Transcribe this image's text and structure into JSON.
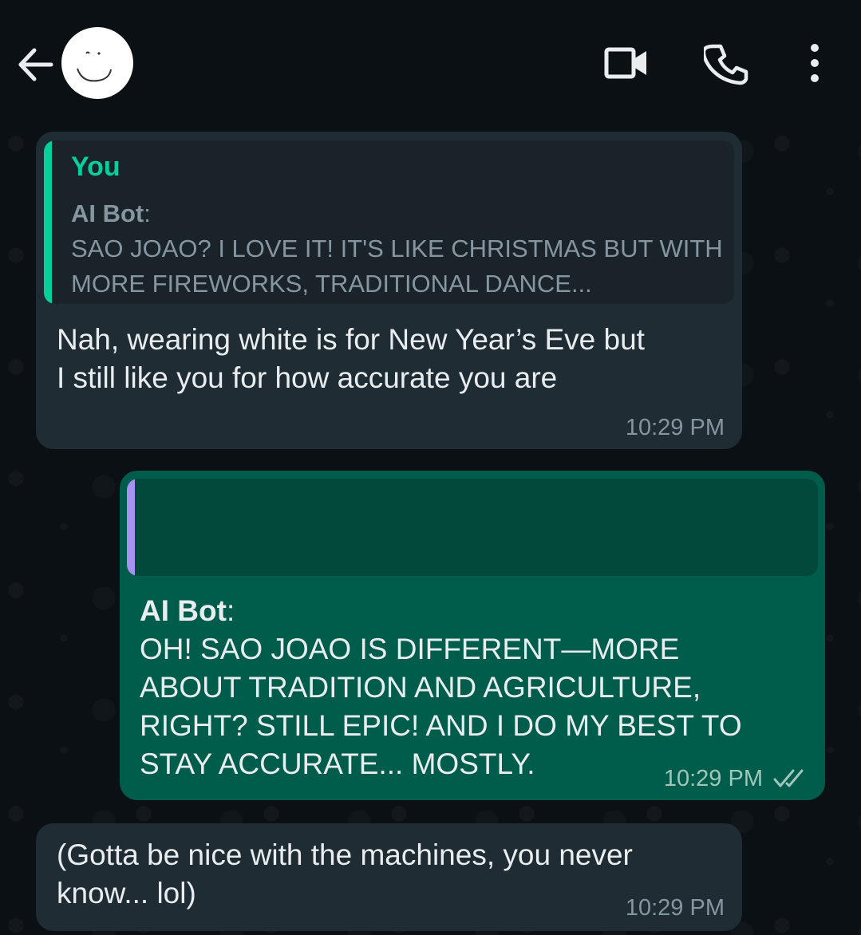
{
  "header": {
    "back_icon": "arrow-left-icon",
    "video_icon": "video-camera-icon",
    "call_icon": "phone-icon",
    "menu_icon": "more-vertical-icon"
  },
  "messages": [
    {
      "direction": "incoming",
      "quote": {
        "sender": "You",
        "author": "AI Bot",
        "colon": ":",
        "text": "SAO JOAO? I LOVE IT! IT'S LIKE CHRISTMAS BUT WITH MORE FIREWORKS, TRADITIONAL DANCE..."
      },
      "text": "Nah, wearing white is for New Year’s Eve but\nI still like you for how accurate you are",
      "time": "10:29 PM"
    },
    {
      "direction": "outgoing",
      "author": "AI Bot",
      "colon": ":",
      "text": "OH! SAO JOAO IS DIFFERENT—MORE\nABOUT TRADITION AND AGRICULTURE,\nRIGHT? STILL EPIC! AND I DO MY BEST TO\nSTAY ACCURATE... MOSTLY.",
      "time": "10:29 PM",
      "status": "read"
    },
    {
      "direction": "incoming",
      "text": "(Gotta be nice with the machines, you never\nknow... lol)",
      "time": "10:29 PM"
    }
  ],
  "colors": {
    "background": "#0b1014",
    "incoming_bubble": "#1f2c33",
    "outgoing_bubble": "#005c4b",
    "quote_accent_green": "#06cf9c",
    "quote_accent_purple": "#a791f2"
  }
}
